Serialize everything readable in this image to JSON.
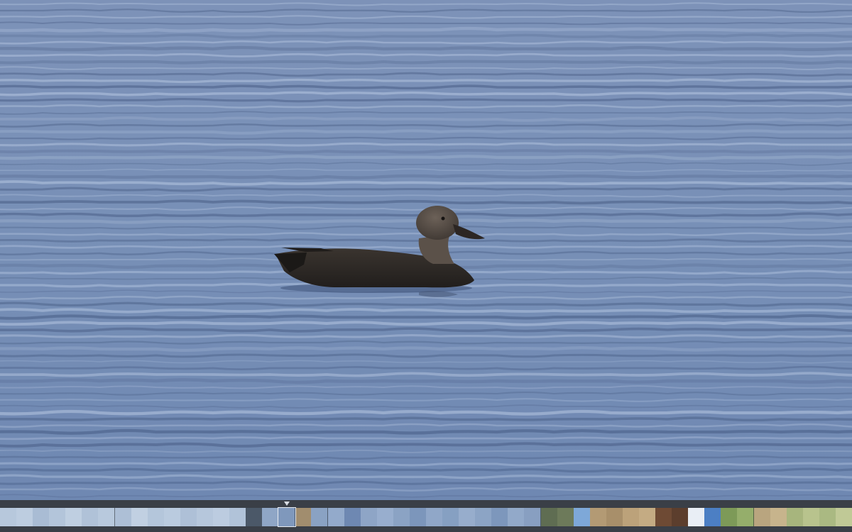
{
  "viewer": {
    "photo_subject": "duck-on-water",
    "colors": {
      "water_base": "#6f86b0",
      "water_light": "#c3d2ea",
      "water_dark": "#3e5279",
      "duck_body": "#2b2724",
      "duck_head": "#5a5049",
      "ui_background": "#3a3f47",
      "marker": "#d7dbe2"
    }
  },
  "filmstrip": {
    "current_index": 17,
    "thumbnails": [
      {
        "scene": "water",
        "color": "#b7c8dc"
      },
      {
        "scene": "water",
        "color": "#bdcde0"
      },
      {
        "scene": "water",
        "color": "#a9bcd4"
      },
      {
        "scene": "water",
        "color": "#b3c5da"
      },
      {
        "scene": "water",
        "color": "#bfcfe1"
      },
      {
        "scene": "water",
        "color": "#b0c2d8"
      },
      {
        "scene": "water",
        "color": "#b8c9dd"
      },
      {
        "scene": "water",
        "color": "#adbfd6"
      },
      {
        "scene": "water",
        "color": "#c1d0e2"
      },
      {
        "scene": "water",
        "color": "#b4c6db"
      },
      {
        "scene": "water",
        "color": "#bacbdf"
      },
      {
        "scene": "water",
        "color": "#aec0d7"
      },
      {
        "scene": "water",
        "color": "#b6c7dc"
      },
      {
        "scene": "water",
        "color": "#bccce0"
      },
      {
        "scene": "water",
        "color": "#b1c3d9"
      },
      {
        "scene": "bird",
        "color": "#4b5868"
      },
      {
        "scene": "water",
        "color": "#8fa6c6"
      },
      {
        "scene": "water",
        "color": "#7f98bc"
      },
      {
        "scene": "shore",
        "color": "#a18d6e"
      },
      {
        "scene": "water",
        "color": "#8aa2c3"
      },
      {
        "scene": "water",
        "color": "#93aacb"
      },
      {
        "scene": "water",
        "color": "#6e88b2"
      },
      {
        "scene": "water",
        "color": "#8ea5c6"
      },
      {
        "scene": "water",
        "color": "#98aece"
      },
      {
        "scene": "water",
        "color": "#8ba3c4"
      },
      {
        "scene": "water",
        "color": "#7c96bb"
      },
      {
        "scene": "water",
        "color": "#90a7c8"
      },
      {
        "scene": "water",
        "color": "#86a0c2"
      },
      {
        "scene": "water",
        "color": "#97adcc"
      },
      {
        "scene": "water",
        "color": "#8ca4c5"
      },
      {
        "scene": "water",
        "color": "#7d97bc"
      },
      {
        "scene": "water",
        "color": "#92a9c9"
      },
      {
        "scene": "water",
        "color": "#889fc1"
      },
      {
        "scene": "trees",
        "color": "#5f6d52"
      },
      {
        "scene": "trees",
        "color": "#6d7a5a"
      },
      {
        "scene": "sky",
        "color": "#7ea8d8"
      },
      {
        "scene": "field",
        "color": "#b39a74"
      },
      {
        "scene": "field",
        "color": "#a88f6a"
      },
      {
        "scene": "field",
        "color": "#bca27a"
      },
      {
        "scene": "field",
        "color": "#c4ab83"
      },
      {
        "scene": "trunk",
        "color": "#6e4a34"
      },
      {
        "scene": "trunk",
        "color": "#5c3e2d"
      },
      {
        "scene": "sky",
        "color": "#e9eef5"
      },
      {
        "scene": "sky",
        "color": "#4c7fc4"
      },
      {
        "scene": "grass",
        "color": "#7d9a58"
      },
      {
        "scene": "grass",
        "color": "#95ae6b"
      },
      {
        "scene": "field",
        "color": "#b9a57f"
      },
      {
        "scene": "field",
        "color": "#c7b48c"
      },
      {
        "scene": "grass",
        "color": "#a7b57d"
      },
      {
        "scene": "grass",
        "color": "#b8c38d"
      },
      {
        "scene": "grass",
        "color": "#aab982"
      },
      {
        "scene": "grass",
        "color": "#c0c996"
      }
    ]
  }
}
